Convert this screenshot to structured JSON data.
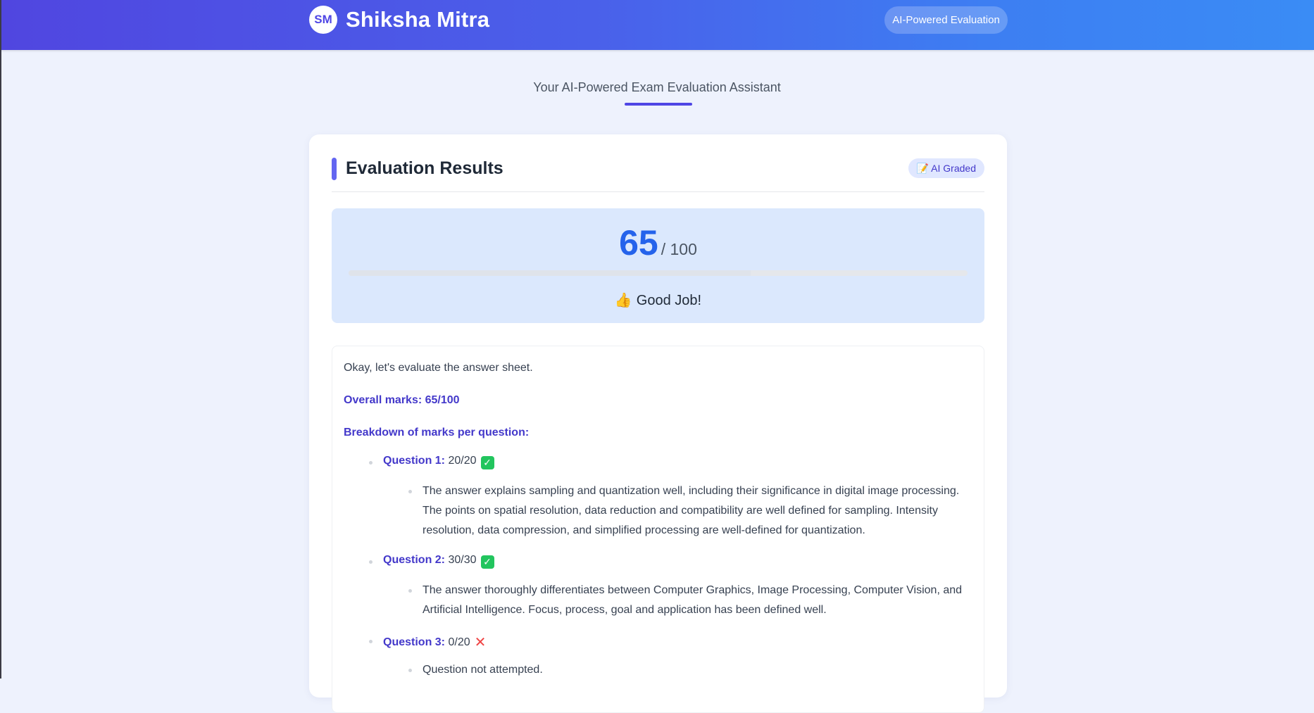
{
  "header": {
    "logo_initials": "SM",
    "app_name": "Shiksha Mitra",
    "badge": "AI-Powered Evaluation"
  },
  "tagline": "Your AI-Powered Exam Evaluation Assistant",
  "results": {
    "title": "Evaluation Results",
    "graded_badge": "📝 AI Graded",
    "score": "65",
    "score_total": "/ 100",
    "score_fraction": 0.65,
    "message_icon": "thumbs-up-icon",
    "message": "Good Job!"
  },
  "feedback": {
    "intro": "Okay, let's evaluate the answer sheet.",
    "overall": "Overall marks: 65/100",
    "breakdown_heading": "Breakdown of marks per question:",
    "questions": [
      {
        "label": "Question 1:",
        "marks": "20/20",
        "status_icon": "check-icon",
        "comment": "The answer explains sampling and quantization well, including their significance in digital image processing. The points on spatial resolution, data reduction and compatibility are well defined for sampling. Intensity resolution, data compression, and simplified processing are well-defined for quantization."
      },
      {
        "label": "Question 2:",
        "marks": "30/30",
        "status_icon": "check-icon",
        "comment": "The answer thoroughly differentiates between Computer Graphics, Image Processing, Computer Vision, and Artificial Intelligence. Focus, process, goal and application has been defined well."
      },
      {
        "label": "Question 3:",
        "marks": "0/20",
        "status_icon": "cross-icon",
        "comment": "Question not attempted."
      }
    ]
  },
  "colors": {
    "accent": "#4f46e5",
    "score": "#2563eb",
    "header_start": "#5046e0",
    "header_end": "#3a8cf5"
  }
}
